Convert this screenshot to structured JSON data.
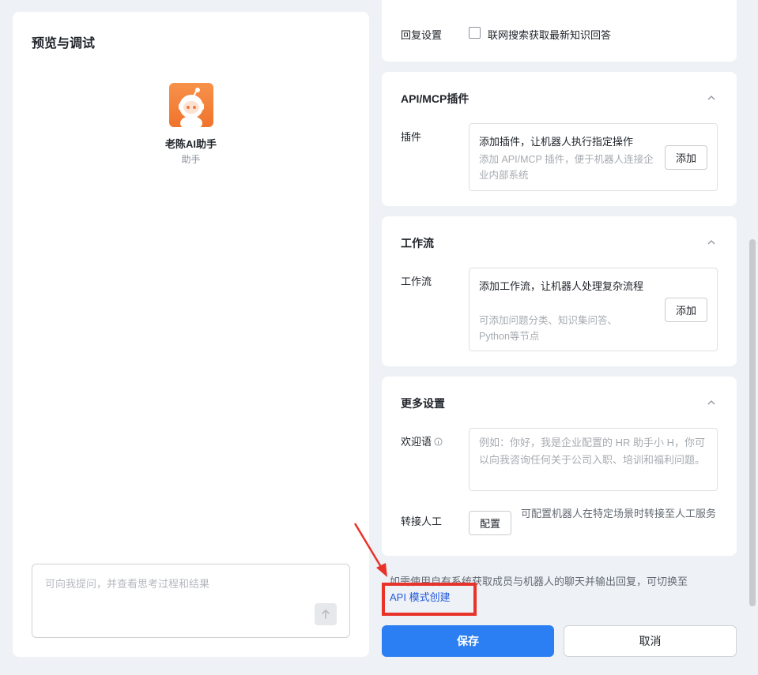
{
  "preview": {
    "title": "预览与调试",
    "bot_name": "老陈AI助手",
    "bot_role": "助手",
    "chat_placeholder": "可向我提问，并查看思考过程和结果"
  },
  "reply_settings": {
    "label": "回复设置",
    "web_search_label": "联网搜索获取最新知识回答",
    "web_search_checked": false
  },
  "plugins": {
    "title": "API/MCP插件",
    "label": "插件",
    "box_title": "添加插件，让机器人执行指定操作",
    "box_desc": "添加 API/MCP 插件，便于机器人连接企业内部系统",
    "add_label": "添加"
  },
  "workflow": {
    "title": "工作流",
    "label": "工作流",
    "box_title": "添加工作流，让机器人处理复杂流程",
    "box_desc": "可添加问题分类、知识集问答、Python等节点",
    "add_label": "添加"
  },
  "more_settings": {
    "title": "更多设置",
    "welcome_label": "欢迎语",
    "welcome_placeholder": "例如：你好，我是企业配置的 HR 助手小 H，你可以向我咨询任何关于公司入职、培训和福利问题。",
    "handoff_label": "转接人工",
    "handoff_button": "配置",
    "handoff_desc": "可配置机器人在特定场景时转接至人工服务"
  },
  "footer": {
    "hint": "如需使用自有系统获取成员与机器人的聊天并输出回复，可切换至",
    "api_link": "API 模式创建",
    "save_label": "保存",
    "cancel_label": "取消"
  },
  "colors": {
    "primary": "#2b7ff2",
    "link": "#245bdb",
    "annotation_red": "#e8332a",
    "avatar_orange": "#f0732c"
  }
}
